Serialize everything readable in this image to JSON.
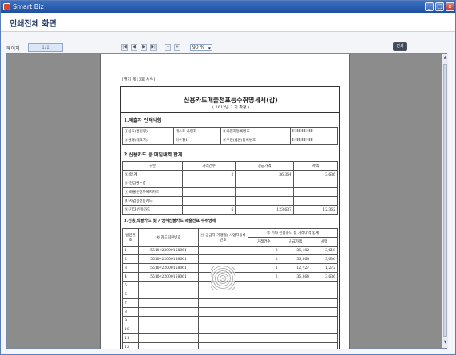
{
  "window": {
    "title": "Smart Biz",
    "min": "_",
    "max": "□",
    "close": "x"
  },
  "page_title": "인쇄전체 화면",
  "toolbar": {
    "page_label": "페이지",
    "page_value": "1/1",
    "nav": [
      "|◀",
      "◀",
      "▶",
      "▶|"
    ],
    "zoom_minus": "-",
    "zoom_plus": "+",
    "zoom_value": "90 %",
    "print_label": "인쇄"
  },
  "doc": {
    "form_no": "[별지 제13호 서식]",
    "title": "신용카드매출전표등수취명세서(갑)",
    "subtitle": "( 2012년 2 기 확정 )",
    "sec1": "1.제출자 인적사항",
    "info": [
      [
        "①상호(법인명)",
        "테스트 사업자",
        "②사업자등록번호",
        ""
      ],
      [
        "③성명(대표자)",
        "이수정1",
        "④주민(법인)등록번호",
        ""
      ]
    ],
    "sec2": "2.신용카드 등 매입내역 합계",
    "sum_header": [
      "구분",
      "거래건수",
      "공급가액",
      "세액"
    ],
    "sum_rows": [
      [
        "⑤ 합  계",
        "2",
        "36,364",
        "3,636"
      ],
      [
        "⑥ 현금영수증",
        "",
        "",
        ""
      ],
      [
        "⑦ 화물운전자복지카드",
        "",
        "",
        ""
      ],
      [
        "⑧ 사업용신용카드",
        "",
        "",
        ""
      ],
      [
        "⑨ 기타 신용카드",
        "6",
        "123,637",
        "12,362"
      ]
    ],
    "sec3": "3.신용,직불카드 및 기명식선불카드 매출전표 수취명세",
    "det_header1": [
      "일련번호",
      "⑩ 카드회원번호",
      "⑪ 공급자(가맹점) 사업자등록번호",
      "⑫ 기타 신용카드 등 거래내역 합계"
    ],
    "det_header2": [
      "거래건수",
      "공급가액",
      "세액"
    ],
    "det_rows": [
      [
        "1",
        "5510422000158061",
        "",
        "2",
        "36,182",
        "3,618"
      ],
      [
        "2",
        "5510422000158061",
        "",
        "2",
        "36,364",
        "3,636"
      ],
      [
        "3",
        "5510422000158061",
        "",
        "1",
        "12,727",
        "1,272"
      ],
      [
        "4",
        "5510422000158061",
        "",
        "2",
        "36,364",
        "3,636"
      ],
      [
        "5",
        "",
        "",
        "",
        "",
        ""
      ],
      [
        "6",
        "",
        "",
        "",
        "",
        ""
      ],
      [
        "7",
        "",
        "",
        "",
        "",
        ""
      ],
      [
        "8",
        "",
        "",
        "",
        "",
        ""
      ],
      [
        "9",
        "",
        "",
        "",
        "",
        ""
      ],
      [
        "10",
        "",
        "",
        "",
        "",
        ""
      ],
      [
        "11",
        "",
        "",
        "",
        "",
        ""
      ],
      [
        "12",
        "",
        "",
        "",
        "",
        ""
      ]
    ]
  }
}
